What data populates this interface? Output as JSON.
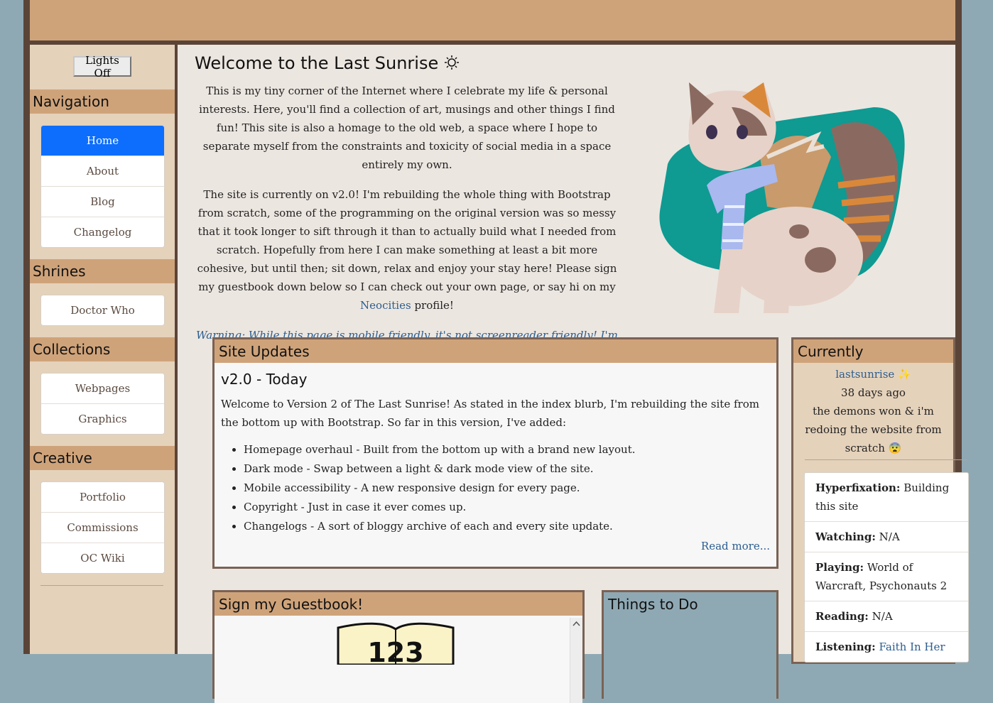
{
  "sidebar": {
    "lights_button": "Lights Off",
    "navigation": {
      "title": "Navigation",
      "items": [
        {
          "label": "Home",
          "active": true
        },
        {
          "label": "About"
        },
        {
          "label": "Blog"
        },
        {
          "label": "Changelog"
        }
      ]
    },
    "shrines": {
      "title": "Shrines",
      "items": [
        {
          "label": "Doctor Who"
        }
      ]
    },
    "collections": {
      "title": "Collections",
      "items": [
        {
          "label": "Webpages"
        },
        {
          "label": "Graphics"
        }
      ]
    },
    "creative": {
      "title": "Creative",
      "items": [
        {
          "label": "Portfolio"
        },
        {
          "label": "Commissions"
        },
        {
          "label": "OC Wiki"
        }
      ]
    }
  },
  "welcome": {
    "title": "Welcome to the Last Sunrise",
    "title_icon": "sun-icon",
    "para1": "This is my tiny corner of the Internet where I celebrate my life & personal interests. Here, you'll find a collection of art, musings and other things I find fun! This site is also a homage to the old web, a space where I hope to separate myself from the constraints and toxicity of social media in a space entirely my own.",
    "para2_before": "The site is currently on v2.0! I'm rebuilding the whole thing with Bootstrap from scratch, some of the programming on the original version was so messy that it took longer to sift through it than to actually build what I needed from scratch. Hopefully from here I can make something at least a bit more cohesive, but until then; sit down, relax and enjoy your stay here! Please sign my guestbook down below so I can check out your own page, or say hi on my",
    "para2_link": "Neocities",
    "para2_after": "profile!",
    "warning": "Warning: While this page is mobile friendly, it's not screenreader friendly! I'm planning on eventually overhauling the site to be as such."
  },
  "updates": {
    "title": "Site Updates",
    "subtitle": "v2.0 - Today",
    "intro": "Welcome to Version 2 of The Last Sunrise! As stated in the index blurb, I'm rebuilding the site from the bottom up with Bootstrap. So far in this version, I've added:",
    "items": [
      "Homepage overhaul - Built from the bottom up with a brand new layout.",
      "Dark mode - Swap between a light & dark mode view of the site.",
      "Mobile accessibility - A new responsive design for every page.",
      "Copyright - Just in case it ever comes up.",
      "Changelogs - A sort of bloggy archive of each and every site update."
    ],
    "read_more": "Read more..."
  },
  "currently": {
    "title": "Currently",
    "user": "lastsunrise",
    "user_icon": "sparkles-icon",
    "time_ago": "38 days ago",
    "status": "the demons won & i'm redoing the website from scratch",
    "status_icon": "fearful-face-icon",
    "items": [
      {
        "label": "Hyperfixation:",
        "value": "Building this site"
      },
      {
        "label": "Watching:",
        "value": "N/A"
      },
      {
        "label": "Playing:",
        "value": "World of Warcraft, Psychonauts 2"
      },
      {
        "label": "Reading:",
        "value": "N/A"
      },
      {
        "label": "Listening:",
        "value": "Faith In Her",
        "link": true
      }
    ]
  },
  "guestbook": {
    "title": "Sign my Guestbook!",
    "counter_text": "123"
  },
  "todo": {
    "title": "Things to Do"
  },
  "colors": {
    "accent": "#cfa37a",
    "frame": "#5a4438",
    "link": "#2b5d8f",
    "active_nav": "#0d6efd",
    "background": "#8fa9b4"
  }
}
